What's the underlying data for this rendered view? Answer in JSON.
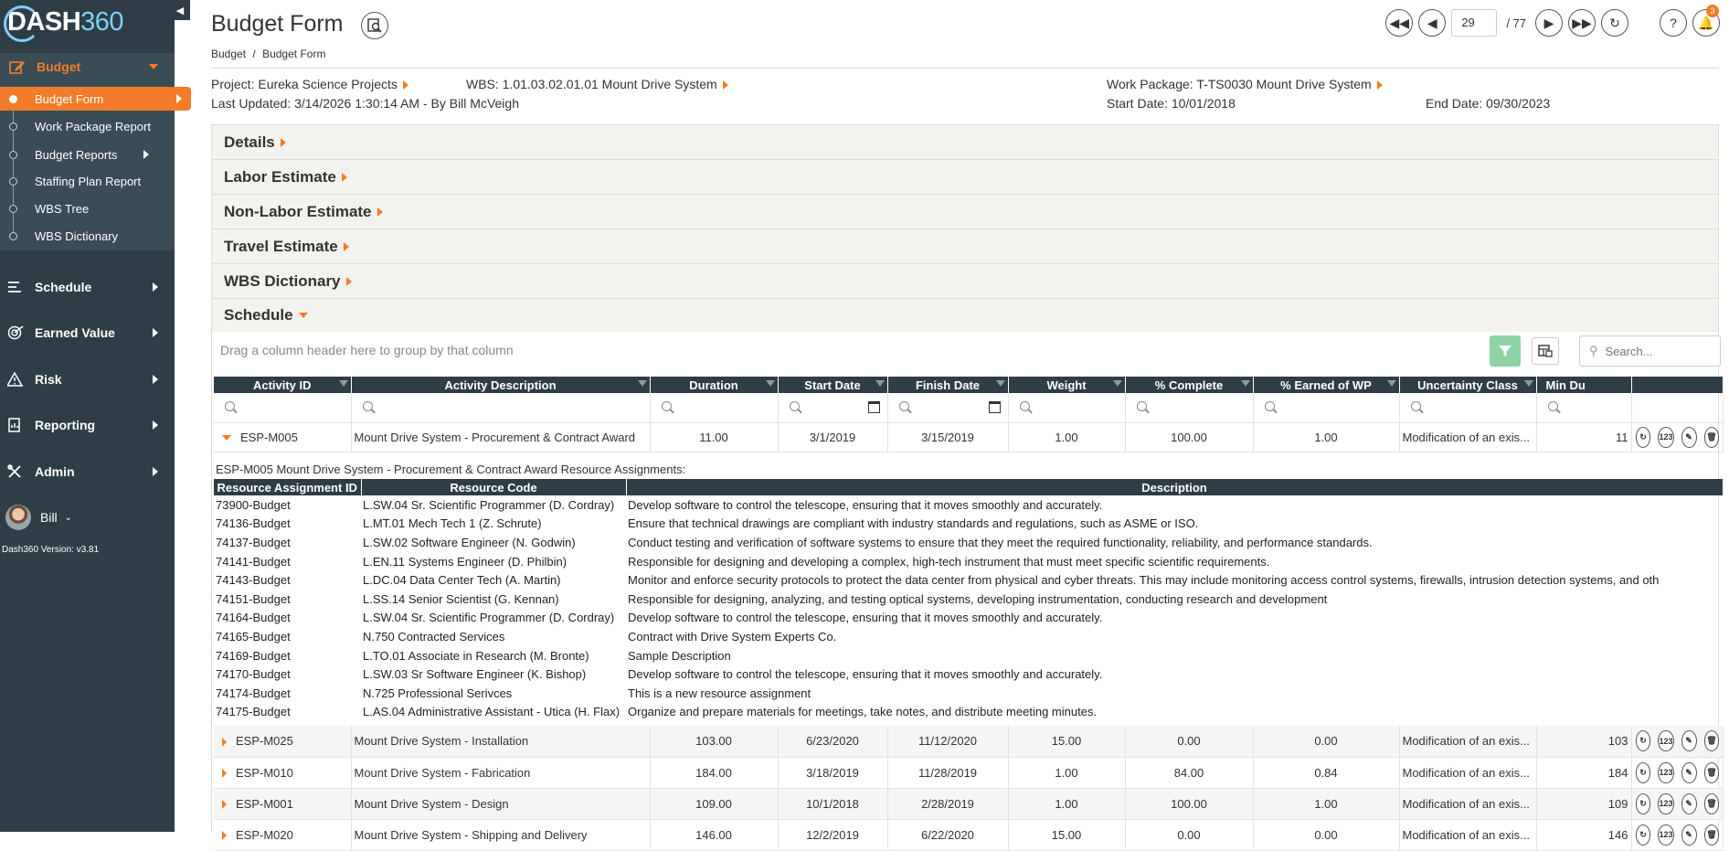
{
  "app": {
    "logo_text": "DASH",
    "logo_num": "360",
    "version": "Dash360 Version: v3.81"
  },
  "sidebar": {
    "budget_label": "Budget",
    "budget_items": [
      {
        "label": "Budget Form"
      },
      {
        "label": "Work Package Report"
      },
      {
        "label": "Budget Reports"
      },
      {
        "label": "Staffing Plan Report"
      },
      {
        "label": "WBS Tree"
      },
      {
        "label": "WBS Dictionary"
      }
    ],
    "main_items": [
      {
        "label": "Schedule"
      },
      {
        "label": "Earned Value"
      },
      {
        "label": "Risk"
      },
      {
        "label": "Reporting"
      },
      {
        "label": "Admin"
      }
    ],
    "user_name": "Bill"
  },
  "header": {
    "title": "Budget Form",
    "breadcrumb": [
      "Budget",
      "/",
      "Budget Form"
    ],
    "page_current": "29",
    "page_total": "/ 77",
    "notifications": "3"
  },
  "info": {
    "project_label": "Project:",
    "project_value": "Eureka Science Projects",
    "wbs_label": "WBS:",
    "wbs_value": "1.01.03.02.01.01 Mount Drive System",
    "wp_label": "Work Package:",
    "wp_value": "T-TS0030 Mount Drive System",
    "updated_label": "Last Updated:",
    "updated_value": "3/14/2026 1:30:14 AM - By Bill McVeigh",
    "start_label": "Start Date:",
    "start_value": "10/01/2018",
    "end_label": "End Date:",
    "end_value": "09/30/2023"
  },
  "panels": [
    "Details",
    "Labor Estimate",
    "Non-Labor Estimate",
    "Travel Estimate",
    "WBS Dictionary",
    "Schedule"
  ],
  "grid": {
    "group_hint": "Drag a column header here to group by that column",
    "search_placeholder": "Search...",
    "columns": [
      "Activity ID",
      "Activity Description",
      "Duration",
      "Start Date",
      "Finish Date",
      "Weight",
      "% Complete",
      "% Earned of WP",
      "Uncertainty Class",
      "Min Du"
    ],
    "rows": [
      {
        "id": "ESP-M005",
        "desc": "Mount Drive System - Procurement & Contract Award",
        "duration": "11.00",
        "start": "3/1/2019",
        "finish": "3/15/2019",
        "weight": "1.00",
        "complete": "100.00",
        "earned": "1.00",
        "uncertainty": "Modification of an exis...",
        "min": "11"
      },
      {
        "id": "ESP-M025",
        "desc": "Mount Drive System - Installation",
        "duration": "103.00",
        "start": "6/23/2020",
        "finish": "11/12/2020",
        "weight": "15.00",
        "complete": "0.00",
        "earned": "0.00",
        "uncertainty": "Modification of an exis...",
        "min": "103"
      },
      {
        "id": "ESP-M010",
        "desc": "Mount Drive System - Fabrication",
        "duration": "184.00",
        "start": "3/18/2019",
        "finish": "11/28/2019",
        "weight": "1.00",
        "complete": "84.00",
        "earned": "0.84",
        "uncertainty": "Modification of an exis...",
        "min": "184"
      },
      {
        "id": "ESP-M001",
        "desc": "Mount Drive System - Design",
        "duration": "109.00",
        "start": "10/1/2018",
        "finish": "2/28/2019",
        "weight": "1.00",
        "complete": "100.00",
        "earned": "1.00",
        "uncertainty": "Modification of an exis...",
        "min": "109"
      },
      {
        "id": "ESP-M020",
        "desc": "Mount Drive System - Shipping and Delivery",
        "duration": "146.00",
        "start": "12/2/2019",
        "finish": "6/22/2020",
        "weight": "15.00",
        "complete": "0.00",
        "earned": "0.00",
        "uncertainty": "Modification of an exis...",
        "min": "146"
      }
    ],
    "action_123": "123"
  },
  "detail": {
    "title": "ESP-M005 Mount Drive System - Procurement & Contract Award Resource Assignments:",
    "columns": [
      "Resource Assignment ID",
      "Resource Code",
      "Description"
    ],
    "rows": [
      {
        "id": "73900-Budget",
        "code": "L.SW.04 Sr. Scientific Programmer (D. Cordray)",
        "desc": "Develop software to control the telescope, ensuring that it moves smoothly and accurately."
      },
      {
        "id": "74136-Budget",
        "code": "L.MT.01 Mech Tech 1 (Z. Schrute)",
        "desc": "Ensure that technical drawings are compliant with industry standards and regulations, such as ASME or ISO."
      },
      {
        "id": "74137-Budget",
        "code": "L.SW.02 Software Engineer (N. Godwin)",
        "desc": "Conduct testing and verification of software systems to ensure that they meet the required functionality, reliability, and performance standards."
      },
      {
        "id": "74141-Budget",
        "code": "L.EN.11 Systems Engineer (D. Philbin)",
        "desc": "Responsible for designing and developing a complex, high-tech instrument that must meet specific scientific requirements."
      },
      {
        "id": "74143-Budget",
        "code": "L.DC.04 Data Center Tech (A. Martin)",
        "desc": "Monitor and enforce security protocols to protect the data center from physical and cyber threats. This may include monitoring access control systems, firewalls, intrusion detection systems, and oth"
      },
      {
        "id": "74151-Budget",
        "code": "L.SS.14 Senior Scientist (G. Kennan)",
        "desc": "Responsible for designing, analyzing, and testing optical systems, developing instrumentation, conducting research and development"
      },
      {
        "id": "74164-Budget",
        "code": "L.SW.04 Sr. Scientific Programmer (D. Cordray)",
        "desc": "Develop software to control the telescope, ensuring that it moves smoothly and accurately."
      },
      {
        "id": "74165-Budget",
        "code": "N.750 Contracted Services",
        "desc": "Contract with Drive System Experts Co."
      },
      {
        "id": "74169-Budget",
        "code": "L.TO.01 Associate in Research (M. Bronte)",
        "desc": "Sample Description"
      },
      {
        "id": "74170-Budget",
        "code": "L.SW.03 Sr Software Engineer (K. Bishop)",
        "desc": "Develop software to control the telescope, ensuring that it moves smoothly and accurately."
      },
      {
        "id": "74174-Budget",
        "code": "N.725 Professional Serivces",
        "desc": "This is a new resource assignment"
      },
      {
        "id": "74175-Budget",
        "code": "L.AS.04 Administrative Assistant - Utica (H. Flax)",
        "desc": "Organize and prepare materials for meetings, take notes, and distribute meeting minutes."
      }
    ]
  }
}
